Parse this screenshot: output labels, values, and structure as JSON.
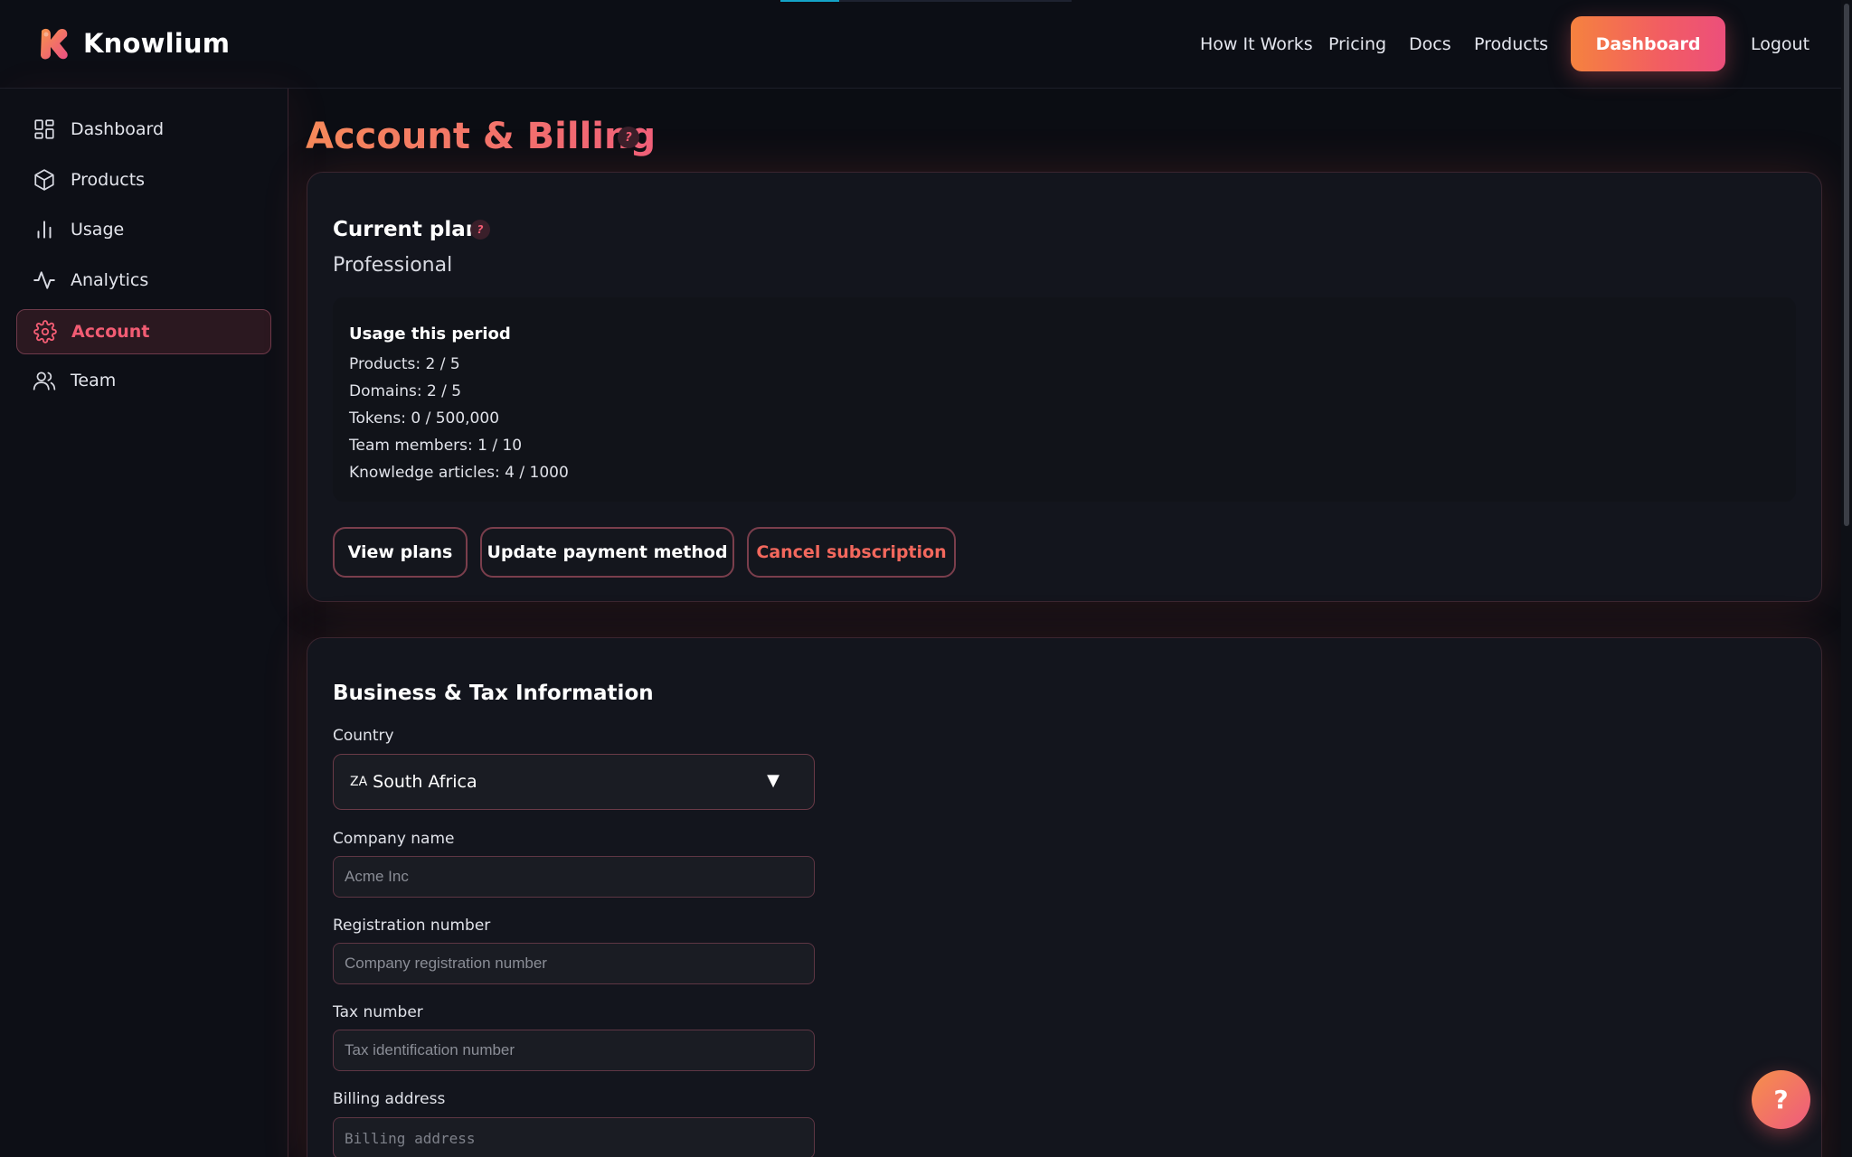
{
  "brand": {
    "name": "Knowlium"
  },
  "nav": {
    "links": [
      "How It Works",
      "Pricing",
      "Docs",
      "Products"
    ],
    "dashboard": "Dashboard",
    "logout": "Logout"
  },
  "sidebar": {
    "items": [
      {
        "label": "Dashboard",
        "icon": "dashboard-grid-icon"
      },
      {
        "label": "Products",
        "icon": "box-icon"
      },
      {
        "label": "Usage",
        "icon": "bar-chart-icon"
      },
      {
        "label": "Analytics",
        "icon": "activity-icon"
      },
      {
        "label": "Account",
        "icon": "gear-icon",
        "active": true
      },
      {
        "label": "Team",
        "icon": "users-icon"
      }
    ]
  },
  "page": {
    "title": "Account & Billing",
    "help": "?"
  },
  "plan": {
    "title": "Current plan",
    "help": "?",
    "name": "Professional",
    "usage_title": "Usage this period",
    "usage": [
      "Products: 2 / 5",
      "Domains: 2 / 5",
      "Tokens: 0 / 500,000",
      "Team members: 1 / 10",
      "Knowledge articles: 4 / 1000"
    ],
    "buttons": {
      "view_plans": "View plans",
      "update_payment": "Update payment method",
      "cancel": "Cancel subscription"
    }
  },
  "business": {
    "title": "Business & Tax Information",
    "country_label": "Country",
    "country_code": "ZA",
    "country_value": "South Africa",
    "company_label": "Company name",
    "company_placeholder": "Acme Inc",
    "registration_label": "Registration number",
    "registration_placeholder": "Company registration number",
    "tax_label": "Tax number",
    "tax_placeholder": "Tax identification number",
    "address_label": "Billing address",
    "address_placeholder": "Billing address"
  },
  "help_fab": "?",
  "colors": {
    "accent": "#f25c73",
    "accent_orange": "#f5823f",
    "background": "#0b0d13",
    "card": "#13151d"
  }
}
